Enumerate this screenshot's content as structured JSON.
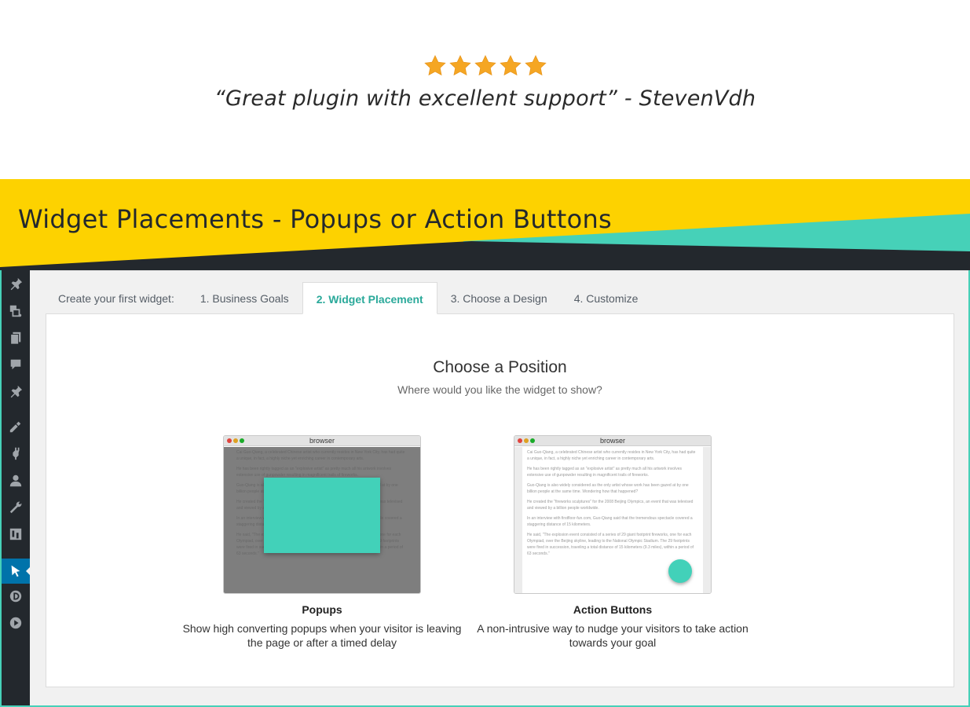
{
  "testimonial": {
    "rating": 5,
    "star_color": "#f5a623",
    "quote": "“Great plugin with excellent support” - StevenVdh"
  },
  "banner": {
    "title": "Widget Placements - Popups or Action Buttons",
    "yellow": "#fdd200",
    "teal": "#46d1b8",
    "dark": "#23282d"
  },
  "sidebar": {
    "icons": [
      "pin-icon",
      "media-icon",
      "pages-icon",
      "comments-icon",
      "pin-icon",
      "appearance-icon",
      "plugins-icon",
      "users-icon",
      "tools-icon",
      "settings-icon",
      "pointer-icon",
      "d-icon",
      "play-icon"
    ],
    "active_index": 10
  },
  "wizard": {
    "intro": "Create your first widget:",
    "tabs": [
      "1. Business Goals",
      "2. Widget Placement",
      "3. Choose a Design",
      "4. Customize"
    ],
    "active_tab": 1,
    "accent": "#2aa99a"
  },
  "panel": {
    "title": "Choose a Position",
    "subtitle": "Where would you like the widget to show?"
  },
  "options": [
    {
      "browser_label": "browser",
      "title": "Popups",
      "description": "Show high converting popups when your visitor is leaving the page or after a timed delay"
    },
    {
      "browser_label": "browser",
      "title": "Action Buttons",
      "description": "A non-intrusive way to nudge your visitors to take action towards your goal"
    }
  ],
  "mock_page_text": [
    "Cai Guo-Qiang, a celebrated Chinese artist who currently resides in New York City, has had quite a unique, in fact, a highly niche yet enriching career in contemporary arts.",
    "He has been rightly tagged as an \"explosive artist\" as pretty much all his artwork involves extensive use of gunpowder resulting in magnificent trails of fireworks.",
    "Guo-Qiang is also widely considered as the only artist whose work has been gazed at by one billion people at the same time. Wondering how that happened?",
    "He created the \"fireworks sculptures\" for the 2008 Beijing Olympics, an event that was televised and viewed by a billion people worldwide.",
    "In an interview with firstfloor-fun.com, Guo-Qiang said that the tremendous spectacle covered a staggering distance of 15 kilometers.",
    "He said, \"The explosion event consisted of a series of 29 giant footprint fireworks, one for each Olympiad, over the Beijing skyline, leading to the National Olympic Stadium. The 29 footprints were fired in succession, traveling a total distance of 15 kilometers (9.3 miles), within a period of 63 seconds.\""
  ]
}
